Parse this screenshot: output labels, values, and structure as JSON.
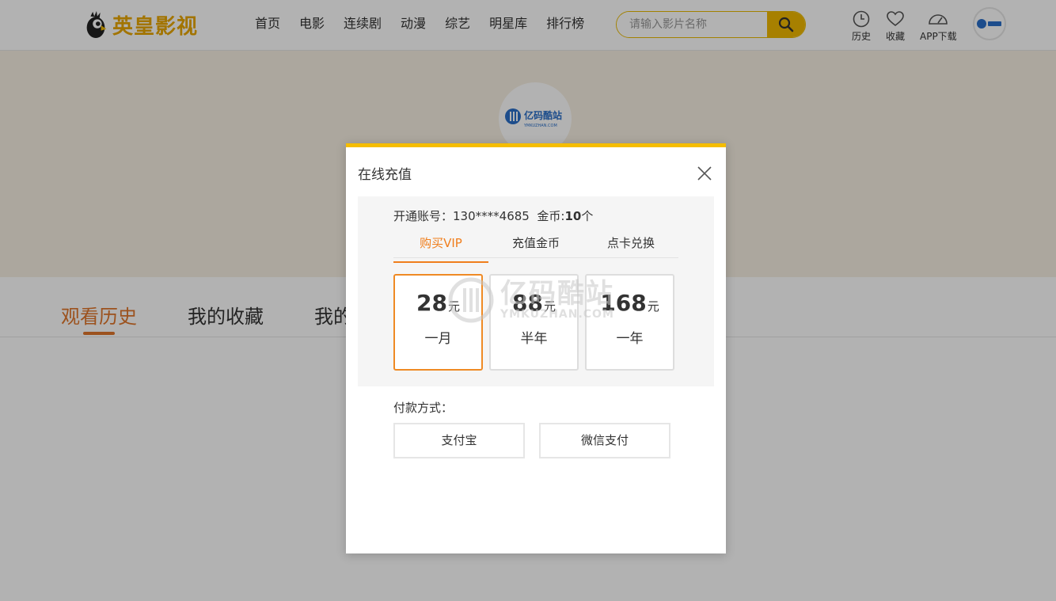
{
  "header": {
    "logo_text": "英皇影视",
    "nav": [
      "首页",
      "电影",
      "连续剧",
      "动漫",
      "综艺",
      "明星库",
      "排行榜"
    ],
    "search_placeholder": "请输入影片名称",
    "tools": {
      "history": "历史",
      "favorites": "收藏",
      "app": "APP下载"
    },
    "avatar_label": "亿码酷站"
  },
  "banner": {
    "avatar_name": "亿码酷站",
    "avatar_sub": "YMKUZHAN.COM"
  },
  "profile_tabs": [
    "观看历史",
    "我的收藏",
    "我的"
  ],
  "modal": {
    "title": "在线充值",
    "account_label": "开通账号：",
    "account_value": "130****4685",
    "coins_label": "金币:",
    "coins_value": "10",
    "coins_unit": "个",
    "tabs": [
      "购买VIP",
      "充值金币",
      "点卡兑换"
    ],
    "active_tab": 0,
    "plans": [
      {
        "price": "28",
        "unit": "元",
        "period": "一月"
      },
      {
        "price": "88",
        "unit": "元",
        "period": "半年"
      },
      {
        "price": "168",
        "unit": "元",
        "period": "一年"
      }
    ],
    "active_plan": 0,
    "pay_label": "付款方式：",
    "pay_methods": [
      "支付宝",
      "微信支付"
    ]
  },
  "watermark": {
    "big": "亿码酷站",
    "small": "YMKUZHAN.COM"
  },
  "colors": {
    "brand_yellow": "#f0b800",
    "accent_orange": "#e0762b",
    "logo_gold": "#e8a600"
  }
}
